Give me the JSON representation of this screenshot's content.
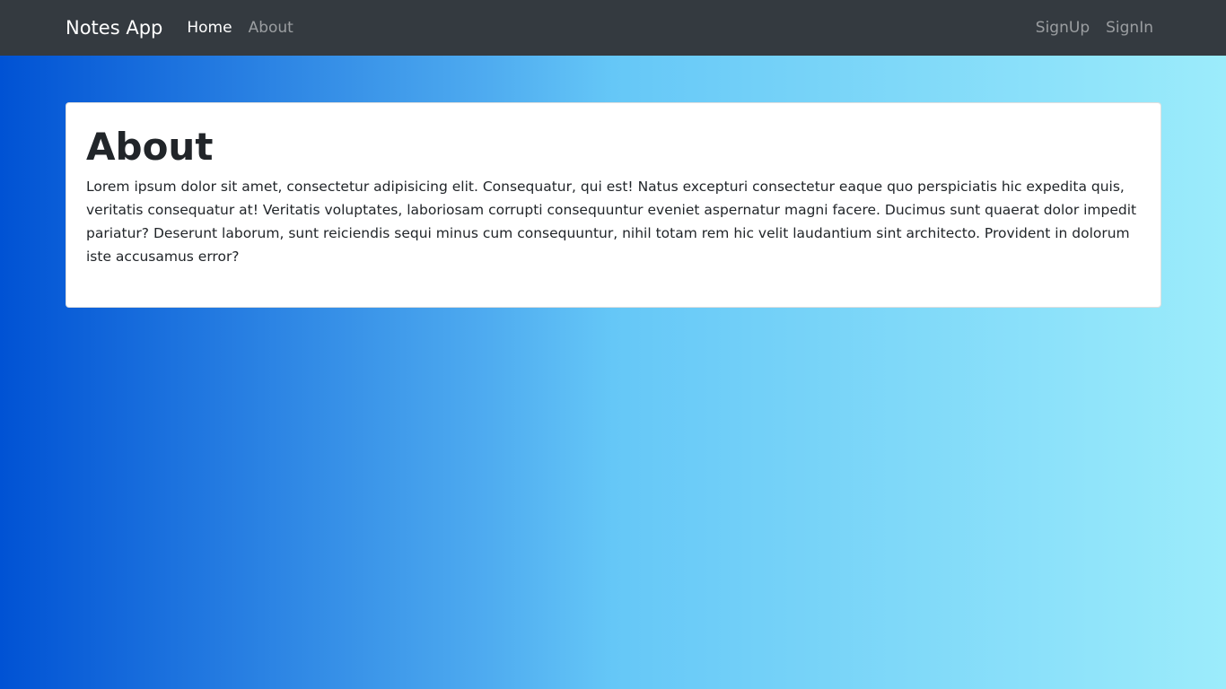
{
  "navbar": {
    "brand": "Notes App",
    "left_links": [
      {
        "label": "Home",
        "active": true
      },
      {
        "label": "About",
        "active": false
      }
    ],
    "right_links": [
      {
        "label": "SignUp"
      },
      {
        "label": "SignIn"
      }
    ]
  },
  "main": {
    "title": "About",
    "body": "Lorem ipsum dolor sit amet, consectetur adipisicing elit. Consequatur, qui est! Natus excepturi consectetur eaque quo perspiciatis hic expedita quis, veritatis consequatur at! Veritatis voluptates, laboriosam corrupti consequuntur eveniet aspernatur magni facere. Ducimus sunt quaerat dolor impedit pariatur? Deserunt laborum, sunt reiciendis sequi minus cum consequuntur, nihil totam rem hic velit laudantium sint architecto. Provident in dolorum iste accusamus error?"
  },
  "colors": {
    "navbar_bg": "#343a40",
    "gradient_start": "#0052d4",
    "gradient_mid": "#65c7f7",
    "gradient_end": "#9cecfb"
  }
}
